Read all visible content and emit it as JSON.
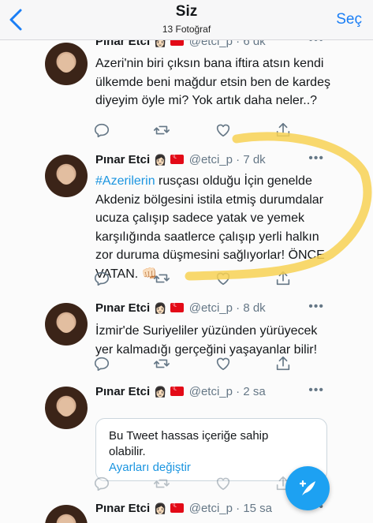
{
  "header": {
    "title": "Siz",
    "subtitle": "13 Fotoğraf",
    "select_label": "Seç"
  },
  "tweets": [
    {
      "name": "Pınar Etci",
      "handle": "@etci_p",
      "time": "· 6 dk",
      "text": "Azeri'nin biri çıksın bana iftira atsın kendi ülkemde beni mağdur etsin ben de kardeş diyeyim öyle mi? Yok artık daha neler..?"
    },
    {
      "name": "Pınar Etci",
      "handle": "@etci_p",
      "time": "· 7 dk",
      "hashtag": "#Azerilerin",
      "text": " rusçası olduğu İçin genelde Akdeniz bölgesini istila etmiş durumdalar ucuza çalışıp sadece yatak ve yemek karşılığında saatlerce çalışıp yerli halkın zor duruma düşmesini sağlıyorlar! ÖNCE VATAN. 👊🏻"
    },
    {
      "name": "Pınar Etci",
      "handle": "@etci_p",
      "time": "· 8 dk",
      "text": "İzmir'de Suriyeliler yüzünden yürüyecek yer kalmadığı gerçeğini yaşayanlar bilir!"
    },
    {
      "name": "Pınar Etci",
      "handle": "@etci_p",
      "time": "· 2 sa",
      "sensitive_message": "Bu Tweet hassas içeriğe sahip olabilir.",
      "sensitive_link": "Ayarları değiştir"
    },
    {
      "name": "Pınar Etci",
      "handle": "@etci_p",
      "time": "· 15 sa"
    }
  ],
  "icons": {
    "back": "chevron-left-icon",
    "reply": "reply-icon",
    "retweet": "retweet-icon",
    "like": "heart-icon",
    "share": "share-icon",
    "compose": "compose-tweet-icon"
  },
  "colors": {
    "accent": "#1a7ef5",
    "twitter_blue": "#1da1f2",
    "highlight": "#f7d154"
  }
}
